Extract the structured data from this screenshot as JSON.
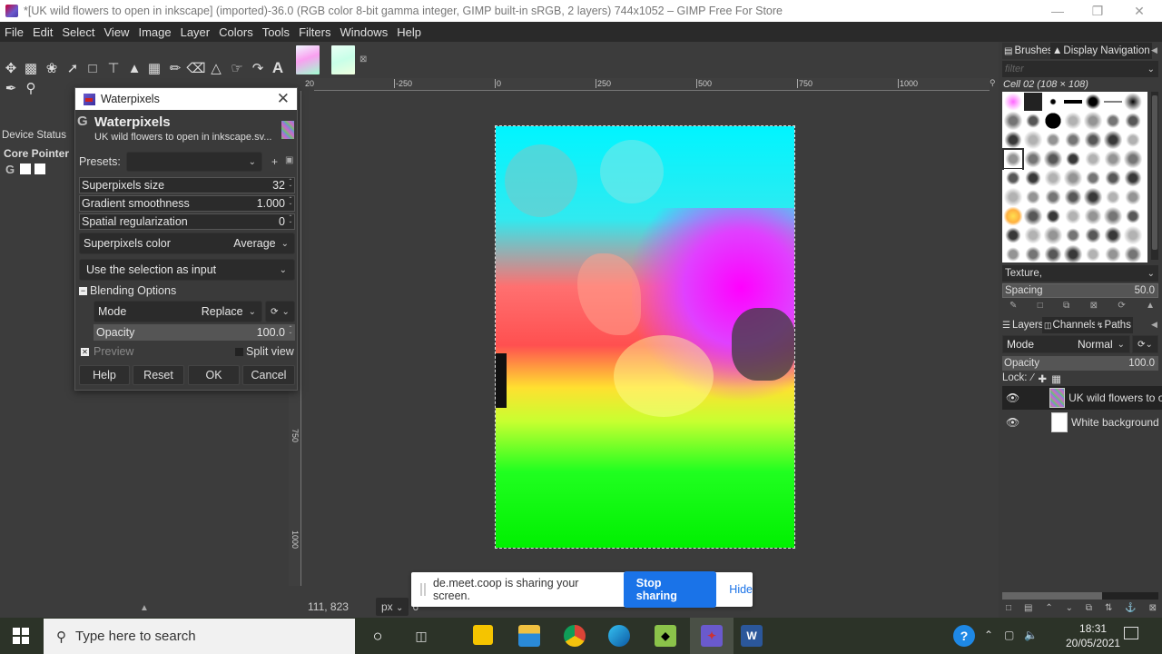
{
  "window": {
    "title": "*[UK wild flowers to open in inkscape] (imported)-36.0 (RGB color 8-bit gamma integer, GIMP built-in sRGB, 2 layers) 744x1052 – GIMP Free For Store",
    "minimize_icon": "minimize-icon",
    "restore_icon": "restore-icon",
    "close_icon": "close-icon"
  },
  "menu": [
    "File",
    "Edit",
    "Select",
    "View",
    "Image",
    "Layer",
    "Colors",
    "Tools",
    "Filters",
    "Windows",
    "Help"
  ],
  "toolbox": {
    "tools": [
      "move-tool",
      "rect-select-tool",
      "free-select-tool",
      "fuzzy-select-tool",
      "crop-tool",
      "unified-transform-tool",
      "warp-transform-tool",
      "gradient-tool",
      "paintbrush-tool",
      "eraser-tool",
      "clone-tool",
      "smudge-tool",
      "paths-tool",
      "text-tool",
      "color-picker-tool",
      "zoom-tool"
    ],
    "device_status_tab": "Device Status",
    "core_pointer": "Core Pointer"
  },
  "dialog": {
    "window_title": "Waterpixels",
    "heading": "Waterpixels",
    "subtitle": "UK wild flowers to open in inkscape.sv...",
    "presets_label": "Presets:",
    "presets_value": "",
    "params": [
      {
        "label": "Superpixels size",
        "value": "32"
      },
      {
        "label": "Gradient smoothness",
        "value": "1.000"
      },
      {
        "label": "Spatial regularization",
        "value": "0"
      }
    ],
    "superpixels_color_label": "Superpixels color",
    "superpixels_color_value": "Average",
    "input_option": "Use the selection as input",
    "blending_header": "Blending Options",
    "mode_label": "Mode",
    "mode_value": "Replace",
    "opacity_label": "Opacity",
    "opacity_value": "100.0",
    "preview_label": "Preview",
    "preview_checked": true,
    "split_view_label": "Split view",
    "split_view_checked": false,
    "buttons": {
      "help": "Help",
      "reset": "Reset",
      "ok": "OK",
      "cancel": "Cancel"
    }
  },
  "canvas": {
    "hruler_labels": [
      "-250",
      "0",
      "250",
      "500",
      "750",
      "1000"
    ],
    "vruler_labels": [
      "750",
      "1000"
    ],
    "origin_label": "20",
    "pointer_coords": "111, 823",
    "unit": "px",
    "zoom_partial": "6"
  },
  "share_banner": {
    "message": "de.meet.coop is sharing your screen.",
    "stop_label": "Stop sharing",
    "hide_label": "Hide",
    "accent": "#1a73e8"
  },
  "brushes": {
    "tab_brushes": "Brushes",
    "tab_navigation": "Display Navigation",
    "filter_placeholder": "filter",
    "selected_brush": "Cell 02 (108 × 108)",
    "tag_value": "Texture,",
    "spacing_label": "Spacing",
    "spacing_value": "50.0"
  },
  "layers": {
    "tab_layers": "Layers",
    "tab_channels": "Channels",
    "tab_paths": "Paths",
    "mode_label": "Mode",
    "mode_value": "Normal",
    "opacity_label": "Opacity",
    "opacity_value": "100.0",
    "lock_label": "Lock:",
    "items": [
      {
        "name": "UK wild flowers to op",
        "visible": true,
        "active": true
      },
      {
        "name": "White background",
        "visible": true,
        "active": false
      }
    ]
  },
  "taskbar": {
    "search_placeholder": "Type here to search",
    "apps": [
      "cortana",
      "task-view",
      "sticky-notes",
      "file-explorer",
      "chrome",
      "edge",
      "inkscape",
      "gimp",
      "word"
    ],
    "time": "18:31",
    "date": "20/05/2021"
  }
}
